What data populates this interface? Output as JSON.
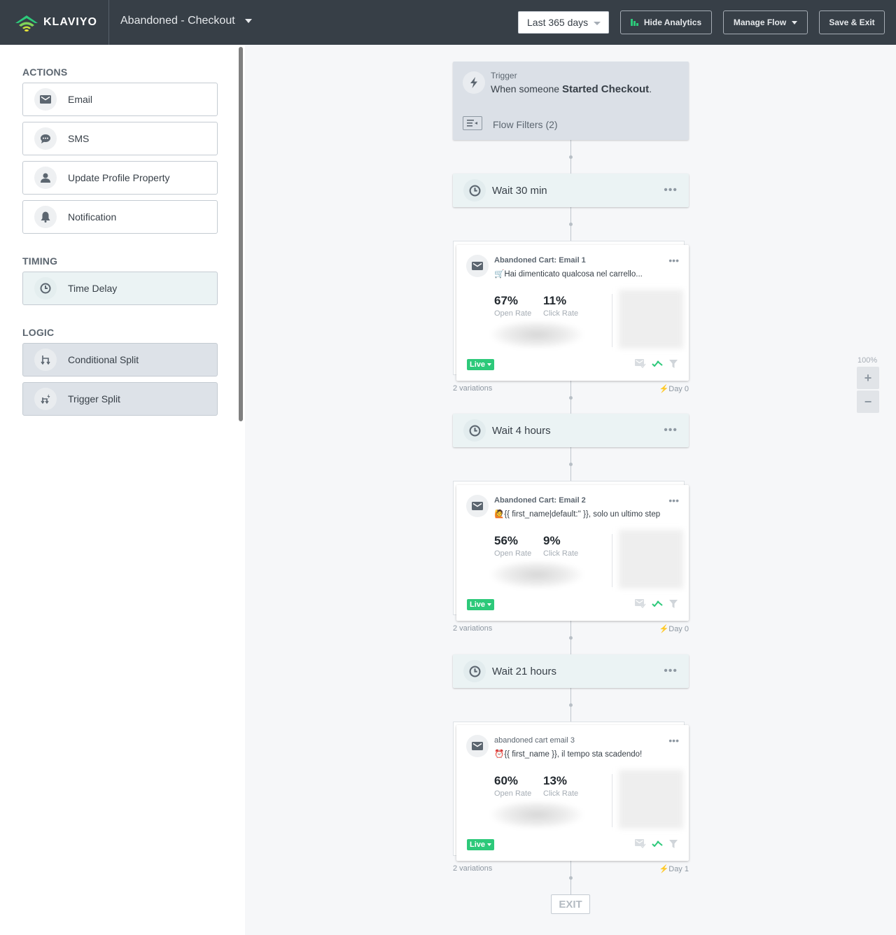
{
  "header": {
    "logo_text": "KLAVIYO",
    "flow_title": "Abandoned - Checkout",
    "date_range": "Last 365 days",
    "hide_analytics": "Hide Analytics",
    "manage_flow": "Manage Flow",
    "save_exit": "Save & Exit",
    "colors": {
      "bar": "#373f47",
      "accent": "#2dc97a"
    }
  },
  "sidebar": {
    "sections": [
      {
        "heading": "ACTIONS",
        "items": [
          {
            "label": "Email",
            "icon": "envelope-icon"
          },
          {
            "label": "SMS",
            "icon": "chat-bubble-icon"
          },
          {
            "label": "Update Profile Property",
            "icon": "user-icon"
          },
          {
            "label": "Notification",
            "icon": "bell-icon"
          }
        ]
      },
      {
        "heading": "TIMING",
        "items": [
          {
            "label": "Time Delay",
            "icon": "clock-icon"
          }
        ]
      },
      {
        "heading": "LOGIC",
        "items": [
          {
            "label": "Conditional Split",
            "icon": "split-icon"
          },
          {
            "label": "Trigger Split",
            "icon": "trigger-split-icon"
          }
        ]
      }
    ]
  },
  "canvas": {
    "trigger": {
      "label": "Trigger",
      "text_prefix": "When someone ",
      "event": "Started Checkout",
      "text_suffix": ".",
      "filters": "Flow Filters (2)"
    },
    "waits": [
      {
        "label": "Wait 30 min"
      },
      {
        "label": "Wait 4 hours"
      },
      {
        "label": "Wait 21 hours"
      }
    ],
    "emails": [
      {
        "name": "Abandoned Cart: Email 1",
        "subject": "🛒Hai dimenticato qualcosa nel carrello...",
        "open_rate": "67%",
        "open_label": "Open Rate",
        "click_rate": "11%",
        "click_label": "Click Rate",
        "status": "Live",
        "variations": "2 variations",
        "day": "Day 0"
      },
      {
        "name": "Abandoned Cart: Email 2",
        "subject": "🙋{{ first_name|default:'' }}, solo un ultimo step",
        "open_rate": "56%",
        "open_label": "Open Rate",
        "click_rate": "9%",
        "click_label": "Click Rate",
        "status": "Live",
        "variations": "2 variations",
        "day": "Day 0"
      },
      {
        "name": "abandoned cart email 3",
        "subject": "⏰{{ first_name }}, il tempo sta scadendo!",
        "open_rate": "60%",
        "open_label": "Open Rate",
        "click_rate": "13%",
        "click_label": "Click Rate",
        "status": "Live",
        "variations": "2 variations",
        "day": "Day 1"
      }
    ],
    "exit_label": "EXIT",
    "zoom": {
      "level": "100%",
      "plus": "+",
      "minus": "−"
    }
  }
}
